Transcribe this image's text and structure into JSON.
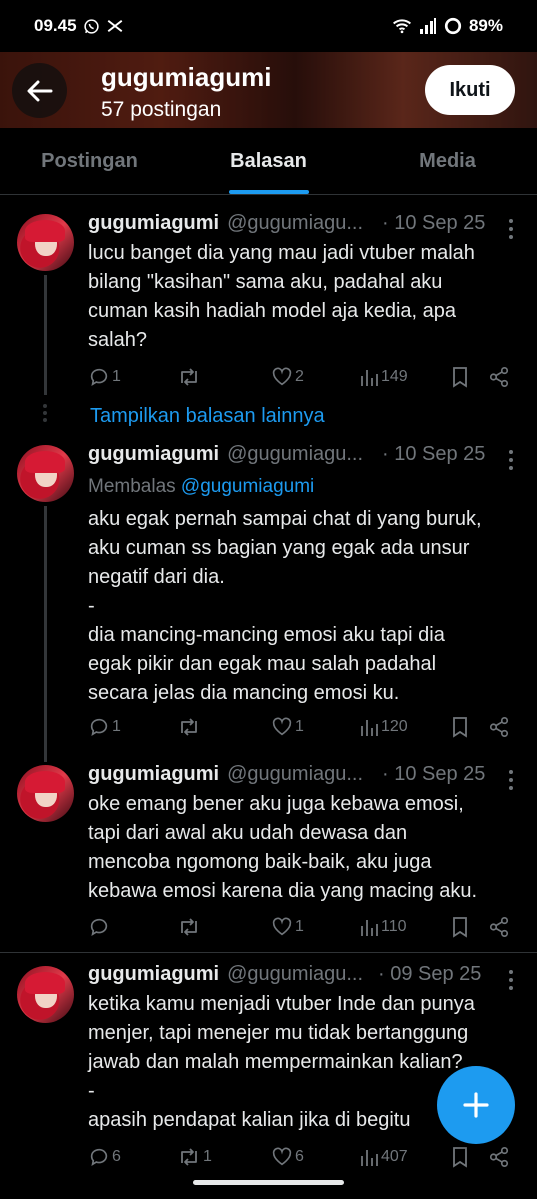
{
  "status_bar": {
    "time": "09.45",
    "battery": "89%"
  },
  "header": {
    "title": "gugumiagumi",
    "subtitle": "57 postingan",
    "follow_label": "Ikuti"
  },
  "tabs": [
    {
      "label": "Postingan",
      "active": false
    },
    {
      "label": "Balasan",
      "active": true
    },
    {
      "label": "Media",
      "active": false
    }
  ],
  "show_more_label": "Tampilkan balasan lainnya",
  "posts": [
    {
      "name": "gugumiagumi",
      "handle": "@gugumiagu...",
      "date": "· 10 Sep 25",
      "reply_prefix": "",
      "reply_mention": "",
      "text": "lucu banget dia yang mau jadi vtuber malah\nbilang \"kasihan\" sama aku, padahal aku\ncuman kasih hadiah model aja kedia, apa\nsalah?",
      "replies": "1",
      "reposts": "",
      "likes": "2",
      "views": "149"
    },
    {
      "name": "gugumiagumi",
      "handle": "@gugumiagu...",
      "date": "· 10 Sep 25",
      "reply_prefix": "Membalas ",
      "reply_mention": "@gugumiagumi",
      "text": "aku egak pernah sampai chat di yang buruk,\naku cuman ss bagian yang egak ada unsur\nnegatif dari dia.\n-\ndia mancing-mancing emosi aku tapi dia\negak pikir dan egak mau salah padahal\nsecara jelas dia mancing emosi ku.",
      "replies": "1",
      "reposts": "",
      "likes": "1",
      "views": "120"
    },
    {
      "name": "gugumiagumi",
      "handle": "@gugumiagu...",
      "date": "· 10 Sep 25",
      "reply_prefix": "",
      "reply_mention": "",
      "text": "oke emang bener aku juga kebawa emosi,\ntapi dari awal aku udah dewasa dan\nmencoba ngomong baik-baik, aku juga\nkebawa emosi karena dia yang macing aku.",
      "replies": "",
      "reposts": "",
      "likes": "1",
      "views": "110"
    },
    {
      "name": "gugumiagumi",
      "handle": "@gugumiagu...",
      "date": "· 09 Sep 25",
      "reply_prefix": "",
      "reply_mention": "",
      "text": "ketika kamu menjadi vtuber Inde dan punya\nmenjer, tapi menejer mu tidak bertanggung\njawab dan malah mempermainkan kalian?\n-\napasih pendapat kalian jika di begitu",
      "replies": "6",
      "reposts": "1",
      "likes": "6",
      "views": "407"
    }
  ],
  "colors": {
    "accent": "#1d9bf0",
    "background": "#000000",
    "muted": "#71767b",
    "text": "#e7e9ea"
  }
}
